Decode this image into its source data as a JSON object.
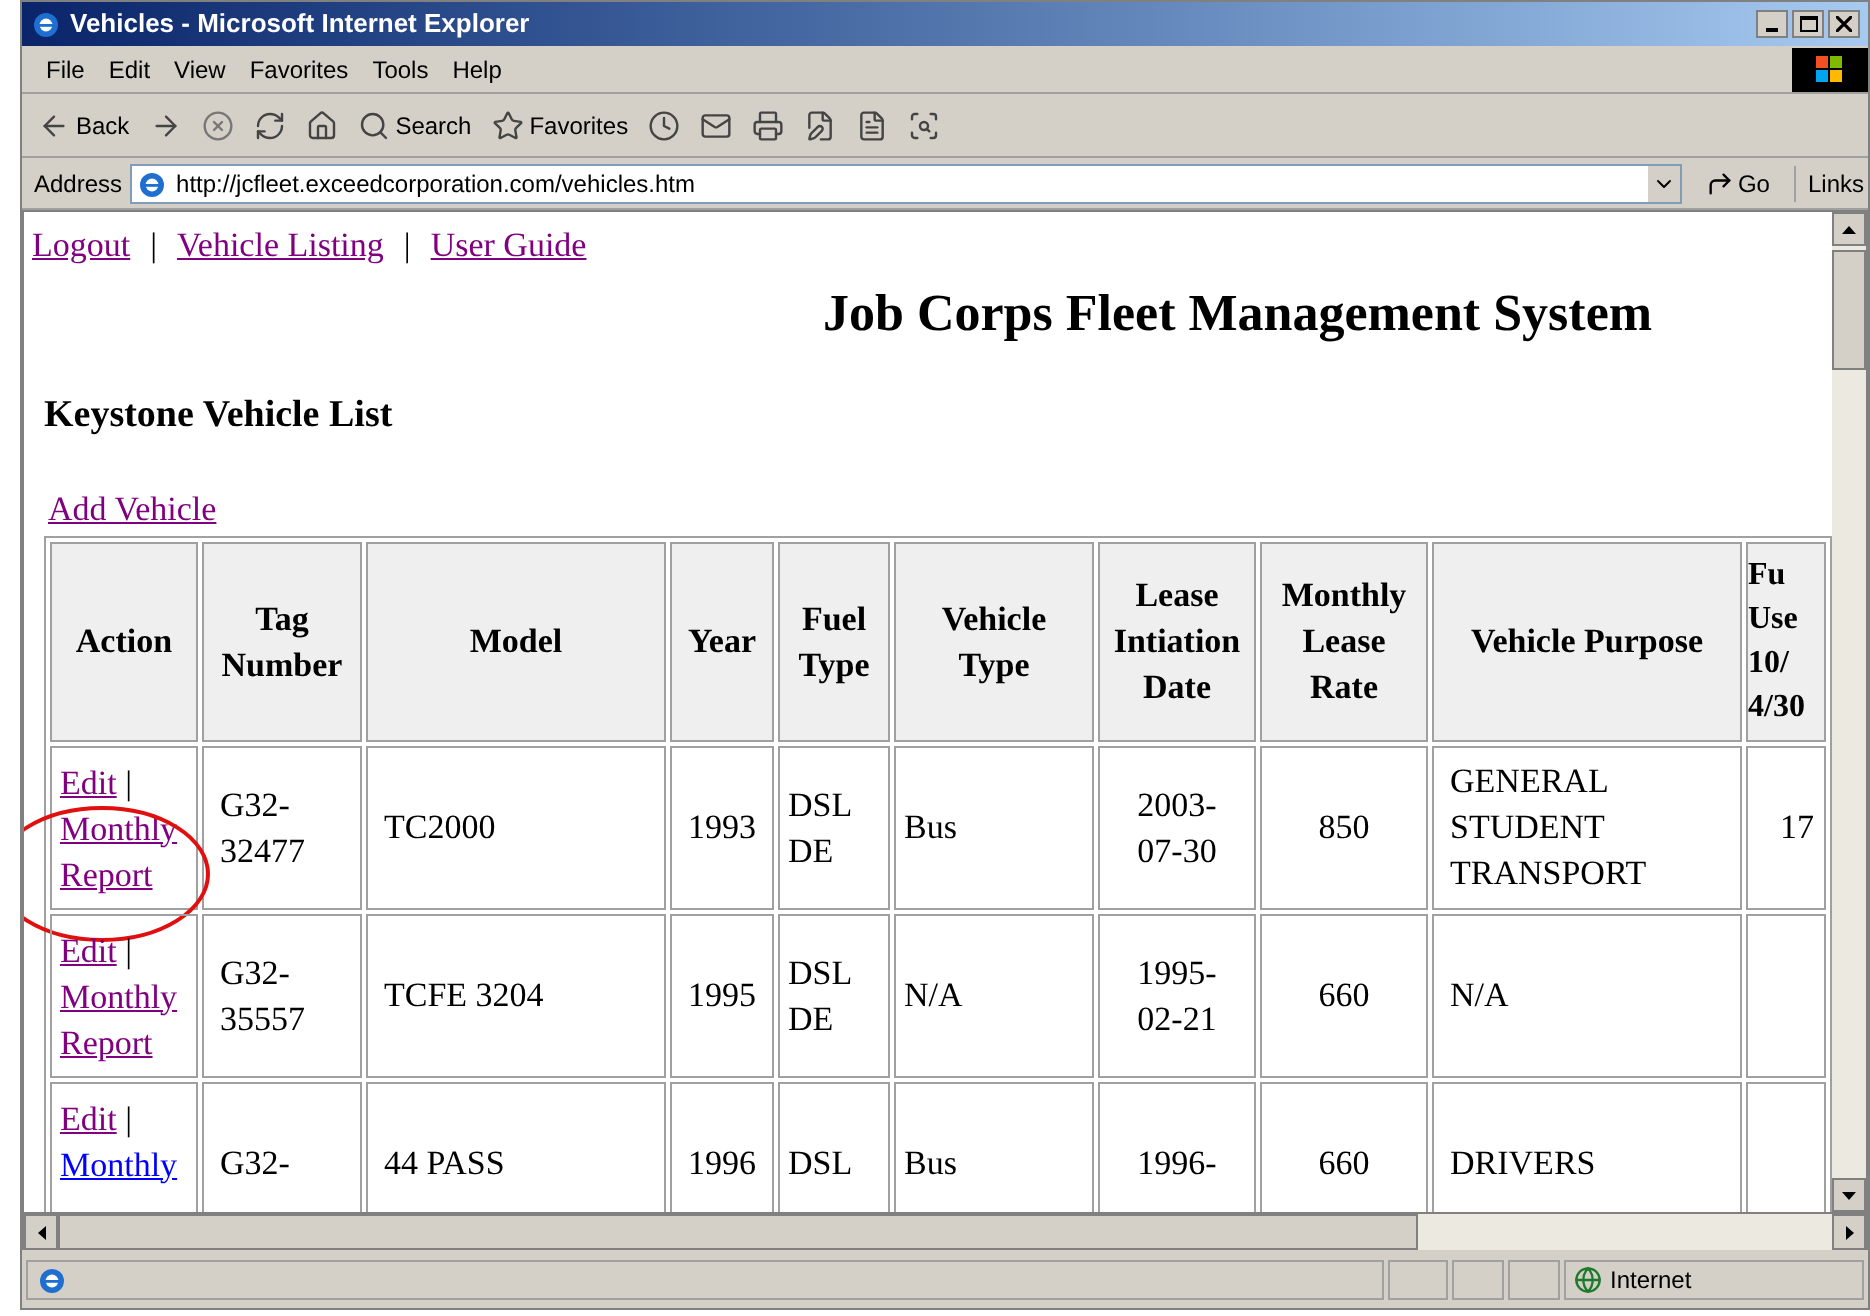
{
  "window": {
    "title": "Vehicles - Microsoft Internet Explorer"
  },
  "menu": [
    "File",
    "Edit",
    "View",
    "Favorites",
    "Tools",
    "Help"
  ],
  "toolbar": [
    {
      "kind": "back",
      "label": "Back"
    },
    {
      "kind": "forward"
    },
    {
      "kind": "stop"
    },
    {
      "kind": "refresh"
    },
    {
      "kind": "home"
    },
    {
      "kind": "search",
      "label": "Search"
    },
    {
      "kind": "favorites",
      "label": "Favorites"
    },
    {
      "kind": "history"
    },
    {
      "kind": "mail"
    },
    {
      "kind": "print"
    },
    {
      "kind": "edit"
    },
    {
      "kind": "discuss"
    },
    {
      "kind": "research"
    }
  ],
  "address": {
    "label": "Address",
    "value": "http://jcfleet.exceedcorporation.com/vehicles.htm",
    "go": "Go",
    "links": "Links"
  },
  "nav_links": [
    {
      "label": "Logout",
      "visited": true
    },
    {
      "label": "Vehicle Listing",
      "visited": true
    },
    {
      "label": "User Guide",
      "visited": true
    }
  ],
  "nav_separators": [
    "|",
    "|"
  ],
  "page_title": "Job Corps Fleet Management System",
  "list_title": "Keystone Vehicle List",
  "add_link": {
    "label": "Add Vehicle",
    "visited": true
  },
  "table": {
    "action_column": "Action",
    "columns": [
      "Tag Number",
      "Model",
      "Year",
      "Fuel Type",
      "Vehicle Type",
      "Lease Intiation Date",
      "Monthly Lease Rate",
      "Vehicle Purpose",
      "Fu\nUse\n10/\n4/30"
    ],
    "rows": [
      {
        "actions": [
          {
            "label": "Edit",
            "visited": true
          },
          {
            "label": "Monthly Report",
            "visited": true
          }
        ],
        "separator": "|",
        "circled": true,
        "cells": [
          "G32-32477",
          "TC2000",
          "1993",
          "DSL DE",
          "Bus",
          "2003-07-30",
          "850",
          "GENERAL STUDENT TRANSPORT",
          "17"
        ]
      },
      {
        "actions": [
          {
            "label": "Edit",
            "visited": true
          },
          {
            "label": "Monthly Report",
            "visited": true
          }
        ],
        "separator": "|",
        "circled": false,
        "cells": [
          "G32-35557",
          "TCFE 3204",
          "1995",
          "DSL DE",
          "N/A",
          "1995-02-21",
          "660",
          "N/A",
          ""
        ]
      },
      {
        "actions": [
          {
            "label": "Edit",
            "visited": true
          },
          {
            "label": "Monthly",
            "visited": false
          }
        ],
        "separator": "|",
        "circled": false,
        "cells": [
          "G32-",
          "44 PASS",
          "1996",
          "DSL",
          "Bus",
          "1996-",
          "660",
          "DRIVERS",
          ""
        ]
      }
    ]
  },
  "status_bar": {
    "zone": "Internet"
  }
}
